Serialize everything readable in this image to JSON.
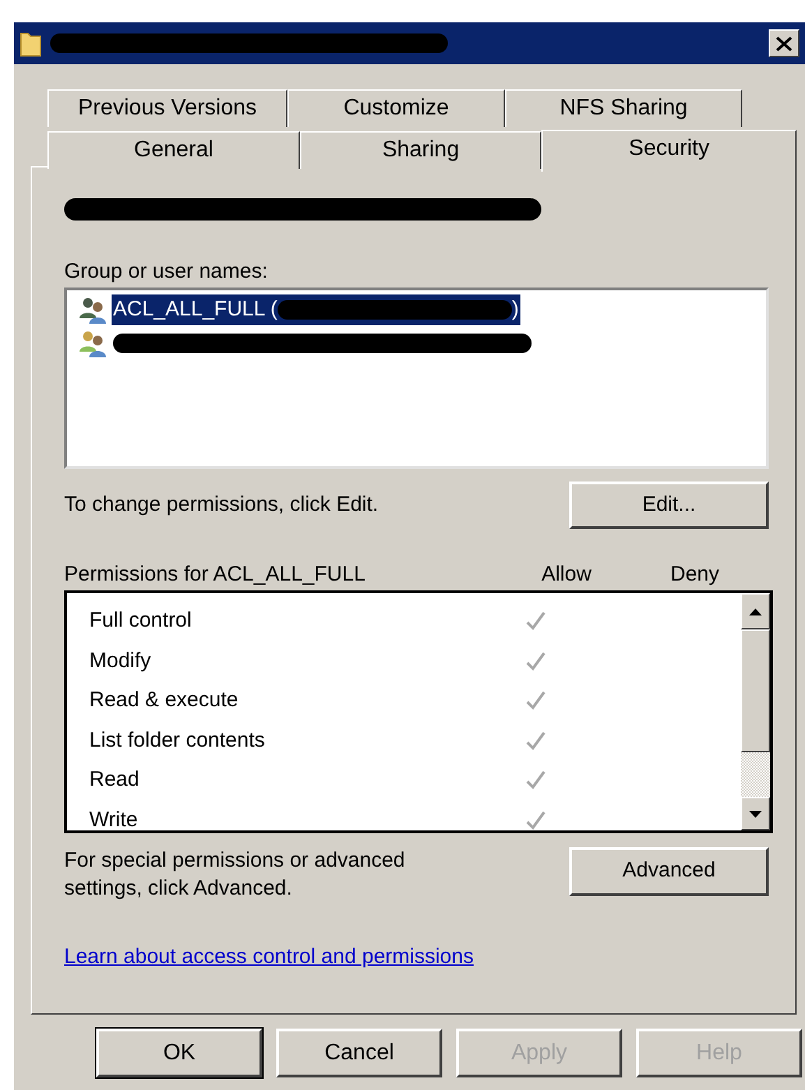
{
  "window": {
    "title_redacted": true
  },
  "tabs": [
    [
      {
        "label": "Previous Versions",
        "selected": false
      },
      {
        "label": "Customize",
        "selected": false
      },
      {
        "label": "NFS Sharing",
        "selected": false
      }
    ],
    [
      {
        "label": "General",
        "selected": false
      },
      {
        "label": "Sharing",
        "selected": false
      },
      {
        "label": "Security",
        "selected": true
      }
    ]
  ],
  "object_name": {
    "redacted": true
  },
  "users": {
    "label": "Group or user names:",
    "items": [
      {
        "name": "ACL_ALL_FULL (",
        "end": ")",
        "redacted": true,
        "selected": true
      },
      {
        "redacted": true,
        "selected": false
      }
    ]
  },
  "change_hint": "To change permissions, click Edit.",
  "edit_button": {
    "label": "Edit..."
  },
  "permissions": {
    "title": "Permissions for ACL_ALL_FULL",
    "allow_label": "Allow",
    "deny_label": "Deny",
    "rows": [
      {
        "name": "Full control",
        "allow": true,
        "deny": false,
        "inherited": true
      },
      {
        "name": "Modify",
        "allow": true,
        "deny": false,
        "inherited": true
      },
      {
        "name": "Read & execute",
        "allow": true,
        "deny": false,
        "inherited": true
      },
      {
        "name": "List folder contents",
        "allow": true,
        "deny": false,
        "inherited": true
      },
      {
        "name": "Read",
        "allow": true,
        "deny": false,
        "inherited": true
      },
      {
        "name": "Write",
        "allow": true,
        "deny": false,
        "inherited": true
      }
    ]
  },
  "advanced_hint": "For special permissions or advanced settings, click Advanced.",
  "advanced_button": {
    "label": "Advanced"
  },
  "link": "Learn about access control and permissions",
  "buttons": [
    {
      "label": "OK",
      "default": true,
      "disabled": false
    },
    {
      "label": "Cancel",
      "default": false,
      "disabled": false
    },
    {
      "label": "Apply",
      "default": false,
      "disabled": true
    },
    {
      "label": "Help",
      "default": false,
      "disabled": true
    }
  ]
}
